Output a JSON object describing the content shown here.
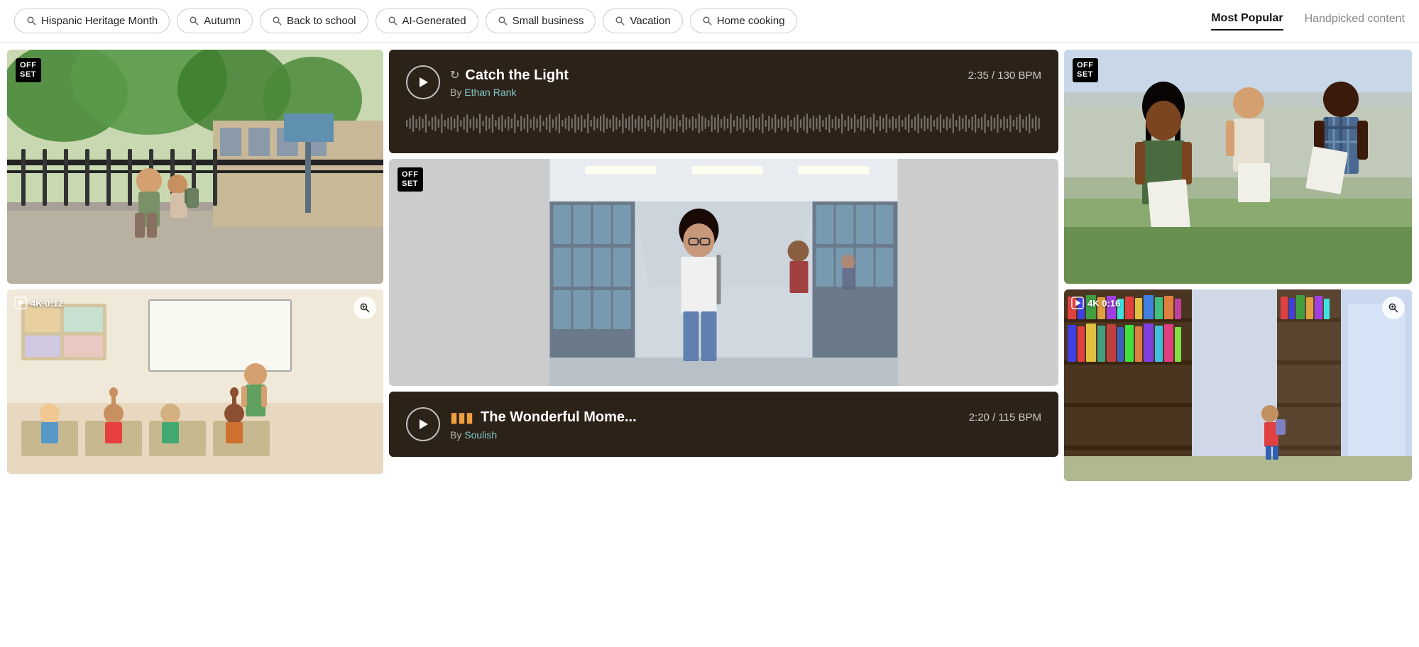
{
  "nav": {
    "pills": [
      {
        "id": "hispanic-heritage-month",
        "label": "Hispanic Heritage Month"
      },
      {
        "id": "autumn",
        "label": "Autumn"
      },
      {
        "id": "back-to-school",
        "label": "Back to school"
      },
      {
        "id": "ai-generated",
        "label": "AI-Generated"
      },
      {
        "id": "small-business",
        "label": "Small business"
      },
      {
        "id": "vacation",
        "label": "Vacation"
      },
      {
        "id": "home-cooking",
        "label": "Home cooking"
      }
    ],
    "tabs": [
      {
        "id": "most-popular",
        "label": "Most Popular",
        "active": true
      },
      {
        "id": "handpicked-content",
        "label": "Handpicked content",
        "active": false
      }
    ]
  },
  "content": {
    "left": {
      "top_image": {
        "badge": "OFF\nSET",
        "alt": "Parent and child in front of school"
      },
      "bottom_image": {
        "video_badge": "4K 0:12",
        "alt": "Elementary classroom with students raising hands"
      }
    },
    "middle": {
      "audio1": {
        "title": "Catch the Light",
        "author": "Ethan Rank",
        "duration": "2:35 / 130 BPM",
        "prefix": "By "
      },
      "hall_image": {
        "badge": "OFF\nSET",
        "alt": "High school students in hallway by lockers"
      },
      "audio2": {
        "title": "The Wonderful Mome...",
        "author": "Soulish",
        "duration": "2:20 / 115 BPM",
        "prefix": "By "
      }
    },
    "right": {
      "top_image": {
        "badge": "OFF\nSET",
        "alt": "Students reading papers outdoors"
      },
      "bottom_image": {
        "video_badge": "4K 0:16",
        "alt": "Library shelves with child walking"
      }
    }
  }
}
